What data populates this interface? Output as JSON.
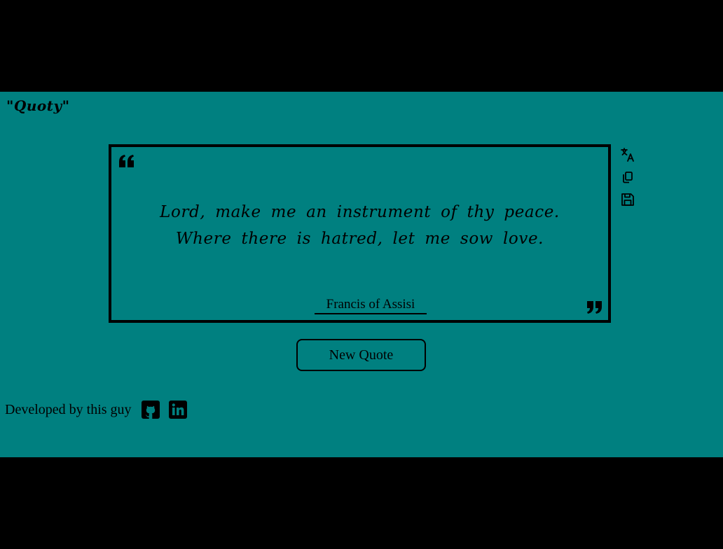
{
  "app": {
    "brand": "\"Quoty\"",
    "background_color": "#008080",
    "frame_color": "#000000"
  },
  "quote": {
    "text": "Lord, make me an instrument of thy peace. Where there is hatred, let me sow love.",
    "author": "Francis of Assisi",
    "open_icon": "open-quote-icon",
    "close_icon": "close-quote-icon"
  },
  "actions": [
    {
      "icon": "translate-icon"
    },
    {
      "icon": "copy-icon"
    },
    {
      "icon": "save-icon"
    }
  ],
  "buttons": {
    "new_quote": "New Quote"
  },
  "footer": {
    "text": "Developed by this guy",
    "links": [
      {
        "icon": "github-icon"
      },
      {
        "icon": "linkedin-icon"
      }
    ]
  }
}
